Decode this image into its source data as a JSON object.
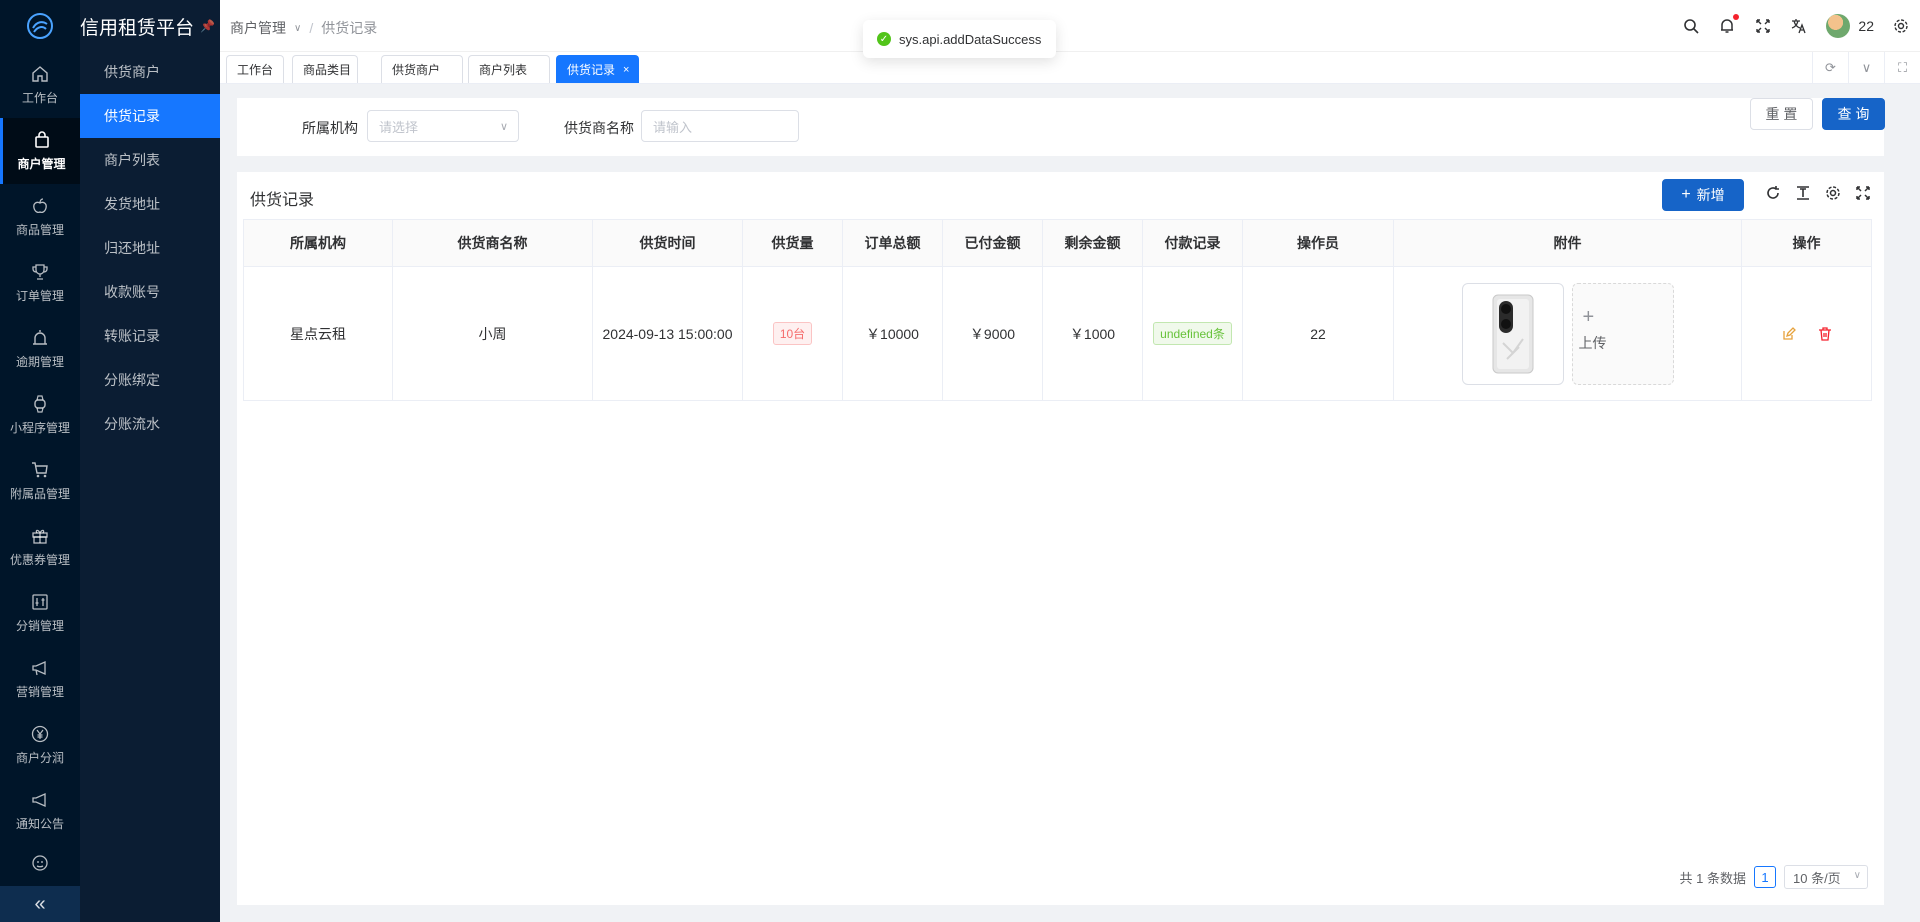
{
  "app": {
    "title": "信用租赁平台"
  },
  "rail": {
    "items": [
      {
        "label": "工作台",
        "icon": "home-icon"
      },
      {
        "label": "商户管理",
        "icon": "shopping-bag-icon",
        "active": true
      },
      {
        "label": "商品管理",
        "icon": "apple-icon"
      },
      {
        "label": "订单管理",
        "icon": "trophy-icon"
      },
      {
        "label": "逾期管理",
        "icon": "alarm-icon"
      },
      {
        "label": "小程序管理",
        "icon": "watch-icon"
      },
      {
        "label": "附属品管理",
        "icon": "cart-icon"
      },
      {
        "label": "优惠券管理",
        "icon": "gift-icon"
      },
      {
        "label": "分销管理",
        "icon": "sliders-icon"
      },
      {
        "label": "营销管理",
        "icon": "megaphone-icon"
      },
      {
        "label": "商户分润",
        "icon": "yen-icon"
      },
      {
        "label": "通知公告",
        "icon": "notice-icon"
      },
      {
        "label": "",
        "icon": "clock-icon"
      }
    ],
    "collapse_icon": "double-chevron-left-icon"
  },
  "submenu": {
    "items": [
      "供货商户",
      "供货记录",
      "商户列表",
      "发货地址",
      "归还地址",
      "收款账号",
      "转账记录",
      "分账绑定",
      "分账流水"
    ],
    "active_index": 1
  },
  "header": {
    "breadcrumb": [
      "商户管理",
      "供货记录"
    ],
    "user_name": "22"
  },
  "tabs": {
    "items": [
      "工作台",
      "商品类目",
      "供货商户",
      "商户列表",
      "供货记录"
    ],
    "active_index": 4,
    "close_glyph": "×"
  },
  "toast": {
    "message": "sys.api.addDataSuccess"
  },
  "filter": {
    "org_label": "所属机构",
    "org_placeholder": "请选择",
    "supplier_label": "供货商名称",
    "supplier_placeholder": "请输入",
    "reset_label": "重 置",
    "query_label": "查 询"
  },
  "table": {
    "title": "供货记录",
    "add_label": "新增",
    "columns": [
      "所属机构",
      "供货商名称",
      "供货时间",
      "供货量",
      "订单总额",
      "已付金额",
      "剩余金额",
      "付款记录",
      "操作员",
      "附件",
      "操作"
    ],
    "rows": [
      {
        "org": "星点云租",
        "supplier": "小周",
        "time": "2024-09-13 15:00:00",
        "quantity": "10台",
        "total": "￥10000",
        "paid": "￥9000",
        "remaining": "￥1000",
        "payment_records": "undefined条",
        "operator": "22",
        "upload_label": "上传"
      }
    ]
  },
  "pagination": {
    "total_text": "共 1 条数据",
    "current_page": "1",
    "page_size": "10 条/页"
  },
  "colors": {
    "sidebar_bg": "#001529",
    "accent": "#1677ff",
    "primary_button": "#1664c8",
    "amount_red": "#f5222d",
    "amount_green": "#389e0d",
    "amount_blue": "#1d39c4"
  }
}
